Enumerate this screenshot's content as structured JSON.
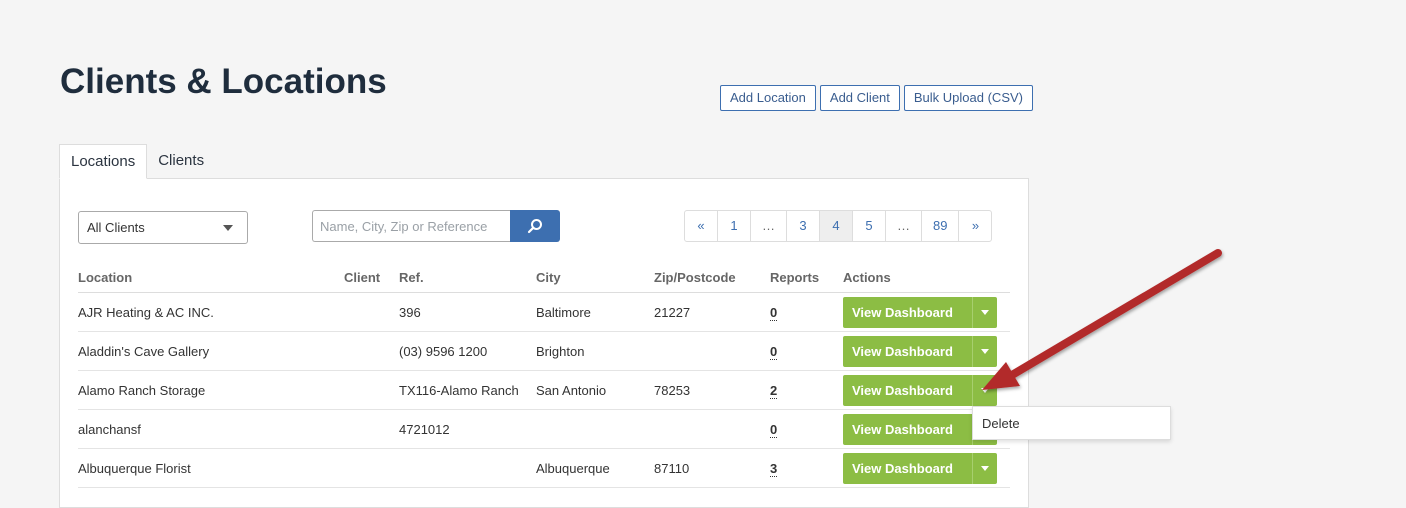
{
  "page": {
    "title": "Clients & Locations"
  },
  "top_actions": {
    "add_location": "Add Location",
    "add_client": "Add Client",
    "bulk_upload": "Bulk Upload (CSV)"
  },
  "tabs": [
    {
      "label": "Locations",
      "active": true
    },
    {
      "label": "Clients",
      "active": false
    }
  ],
  "filters": {
    "client_select_value": "All Clients",
    "search_placeholder": "Name, City, Zip or Reference",
    "search_icon": "search-icon"
  },
  "pagination": [
    "«",
    "1",
    "…",
    "3",
    "4",
    "5",
    "…",
    "89",
    "»"
  ],
  "pagination_active": "4",
  "table": {
    "columns": [
      "Location",
      "Client",
      "Ref.",
      "City",
      "Zip/Postcode",
      "Reports",
      "Actions"
    ],
    "rows": [
      {
        "location": "AJR Heating & AC INC.",
        "client": "",
        "ref": "396",
        "city": "Baltimore",
        "zip": "21227",
        "reports": "0",
        "action": "View Dashboard"
      },
      {
        "location": "Aladdin's Cave Gallery",
        "client": "",
        "ref": "(03) 9596 1200",
        "city": "Brighton",
        "zip": "",
        "reports": "0",
        "action": "View Dashboard"
      },
      {
        "location": "Alamo Ranch Storage",
        "client": "",
        "ref": "TX116-Alamo Ranch",
        "city": "San Antonio",
        "zip": "78253",
        "reports": "2",
        "action": "View Dashboard"
      },
      {
        "location": "alanchansf",
        "client": "",
        "ref": "4721012",
        "city": "",
        "zip": "",
        "reports": "0",
        "action": "View Dashboard"
      },
      {
        "location": "Albuquerque Florist",
        "client": "",
        "ref": "",
        "city": "Albuquerque",
        "zip": "87110",
        "reports": "3",
        "action": "View Dashboard"
      }
    ]
  },
  "dropdown_menu": {
    "items": [
      "Delete"
    ]
  },
  "colors": {
    "primary": "#3d6fb0",
    "action_green": "#8cbd44",
    "annotation_arrow": "#b22a2a"
  }
}
